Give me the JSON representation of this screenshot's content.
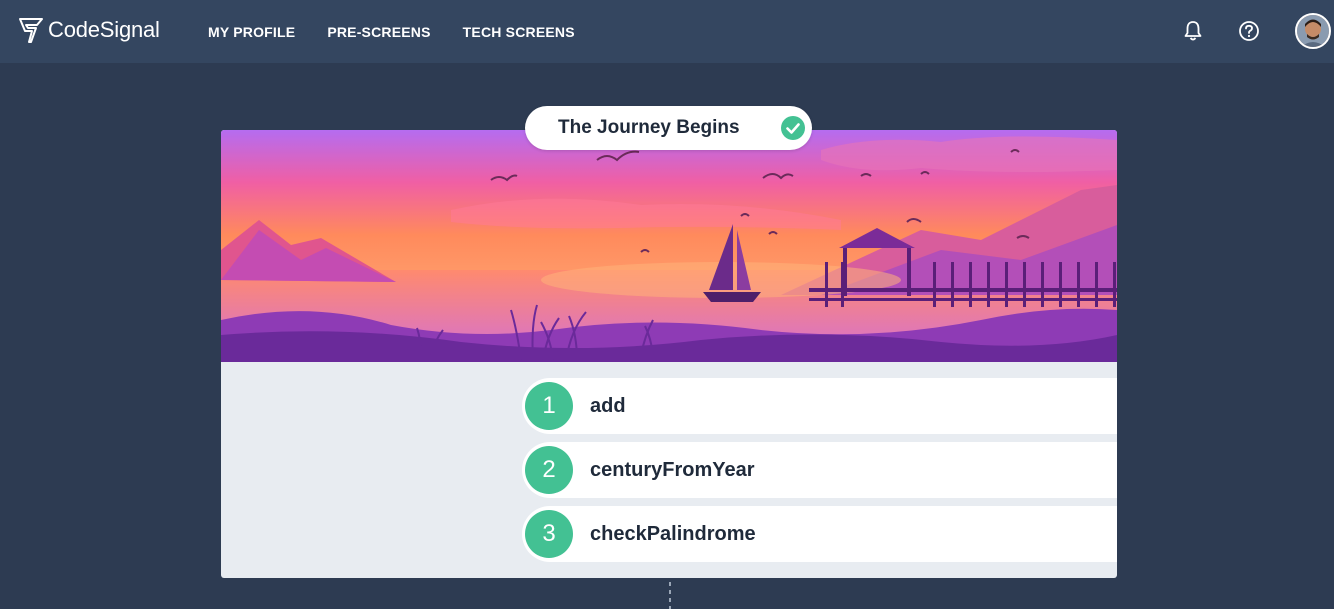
{
  "brand": {
    "name": "CodeSignal",
    "logo_icon": "codesignal-logo-icon"
  },
  "nav": {
    "items": [
      {
        "label": "MY PROFILE"
      },
      {
        "label": "PRE-SCREENS"
      },
      {
        "label": "TECH SCREENS"
      }
    ]
  },
  "top_icons": {
    "notifications": "bell-icon",
    "help": "question-circle-icon",
    "avatar": "user-avatar"
  },
  "journey": {
    "title": "The Journey Begins",
    "completed": true,
    "tasks": [
      {
        "number": "1",
        "name": "add",
        "completed": true
      },
      {
        "number": "2",
        "name": "centuryFromYear",
        "completed": true
      },
      {
        "number": "3",
        "name": "checkPalindrome",
        "completed": true
      }
    ]
  },
  "colors": {
    "background": "#2d3b52",
    "topbar": "#344660",
    "success": "#43c193",
    "card": "#e8ecf1"
  }
}
